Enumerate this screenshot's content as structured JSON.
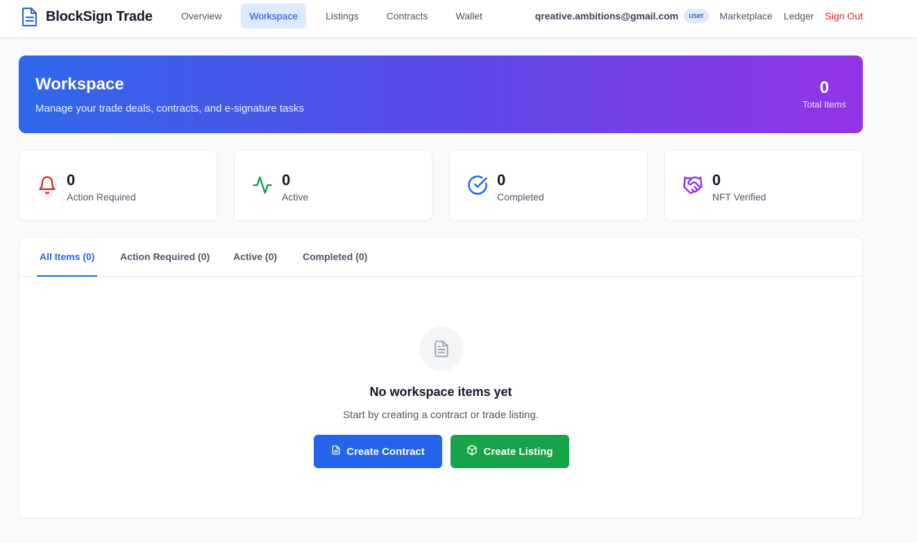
{
  "header": {
    "brand": "BlockSign Trade",
    "nav": [
      {
        "label": "Overview",
        "active": false
      },
      {
        "label": "Workspace",
        "active": true
      },
      {
        "label": "Listings",
        "active": false
      },
      {
        "label": "Contracts",
        "active": false
      },
      {
        "label": "Wallet",
        "active": false
      }
    ],
    "email": "qreative.ambitions@gmail.com",
    "role": "user",
    "links": [
      "Marketplace",
      "Ledger"
    ],
    "sign_out": "Sign Out"
  },
  "hero": {
    "title": "Workspace",
    "subtitle": "Manage your trade deals, contracts, and e-signature tasks",
    "total_value": "0",
    "total_label": "Total Items"
  },
  "stats": [
    {
      "value": "0",
      "label": "Action Required",
      "icon": "bell-icon",
      "color": "#dc2626"
    },
    {
      "value": "0",
      "label": "Active",
      "icon": "activity-icon",
      "color": "#16a34a"
    },
    {
      "value": "0",
      "label": "Completed",
      "icon": "check-circle-icon",
      "color": "#2563eb"
    },
    {
      "value": "0",
      "label": "NFT Verified",
      "icon": "handshake-icon",
      "color": "#9333ea"
    }
  ],
  "tabs": [
    {
      "label": "All Items (0)",
      "active": true
    },
    {
      "label": "Action Required (0)",
      "active": false
    },
    {
      "label": "Active (0)",
      "active": false
    },
    {
      "label": "Completed (0)",
      "active": false
    }
  ],
  "empty": {
    "icon": "document-icon",
    "title": "No workspace items yet",
    "subtitle": "Start by creating a contract or trade listing.",
    "create_contract": "Create Contract",
    "create_listing": "Create Listing"
  },
  "colors": {
    "primary": "#2563eb",
    "success": "#16a34a",
    "danger": "#dc2626",
    "gradient_start": "#2f67ea",
    "gradient_end": "#9334e6"
  }
}
